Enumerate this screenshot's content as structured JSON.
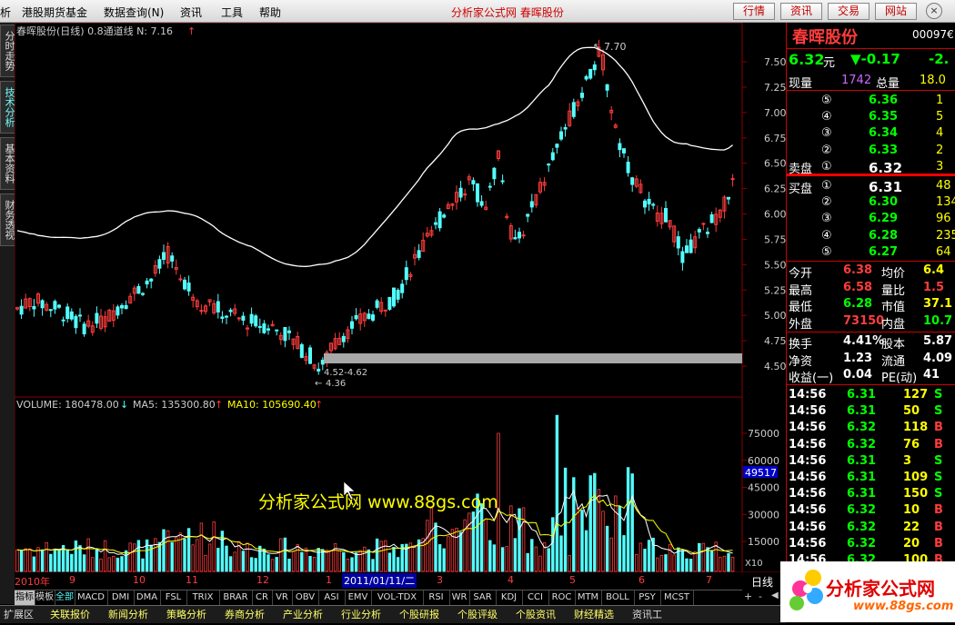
{
  "menubar": {
    "items": [
      "析",
      "港股期货基金",
      "数据查询(N)",
      "资讯",
      "工具",
      "帮助"
    ],
    "title": "分析家公式网 春晖股份",
    "buttons": [
      "行情",
      "资讯",
      "交易",
      "网站"
    ],
    "window_ctrl": "×"
  },
  "left_tabs": [
    "分时走势",
    "技术分析",
    "基本资料",
    "财务透视"
  ],
  "chart": {
    "header": "春晖股份(日线) 0.8通道线  N: 7.16",
    "peak_label": "7.70",
    "low_label": "4.36",
    "range_label": "4.52-4.62",
    "yticks": [
      "7.50",
      "7.25",
      "7.00",
      "6.75",
      "6.50",
      "6.25",
      "6.00",
      "5.75",
      "5.50",
      "5.25",
      "5.00",
      "4.75",
      "4.50"
    ],
    "volume_header": "VOLUME: 180478.00",
    "ma5": "MA5: 135300.80",
    "ma10": "MA10: 105690.40",
    "vol_ticks": [
      "75000",
      "60000",
      "45000",
      "30000",
      "15000"
    ],
    "vol_cursor": "49517",
    "x10": "X10",
    "watermark": "分析家公式网 www.88gs.com",
    "xaxis": [
      "2010年",
      "9",
      "10",
      "11",
      "12",
      "1",
      "2011/01/11/二",
      "3",
      "4",
      "5",
      "6",
      "7"
    ],
    "period": "日线",
    "colors": {
      "up": "#ff3c3c",
      "down": "#54ffff",
      "line": "#ffffff",
      "ma5": "#ffffff",
      "ma10": "#ffff00"
    }
  },
  "indicators": [
    "指标",
    "模板",
    "全部",
    "MACD",
    "DMI",
    "DMA",
    "FSL",
    "TRIX",
    "BRAR",
    "CR",
    "VR",
    "OBV",
    "ASI",
    "EMV",
    "VOL-TDX",
    "RSI",
    "WR",
    "SAR",
    "KDJ",
    "CCI",
    "ROC",
    "MTM",
    "BOLL",
    "PSY",
    "MCST"
  ],
  "bottom_tabs": [
    "扩展区",
    "关联报价",
    "新闻分析",
    "策略分析",
    "券商分析",
    "产业分析",
    "行业分析",
    "个股研报",
    "个股评级",
    "个股资讯",
    "财经精选",
    "资讯工"
  ],
  "quote": {
    "name": "春晖股份",
    "code": "00097€",
    "price": "6.32",
    "price_unit": "元",
    "change": "▼-0.17",
    "pct": "-2.",
    "xianliang_label": "现量",
    "xianliang": "1742",
    "zongliang_label": "总量",
    "zongliang": "18.0",
    "sell": [
      {
        "lv": "⑤",
        "price": "6.36",
        "vol": "1"
      },
      {
        "lv": "④",
        "price": "6.35",
        "vol": "5"
      },
      {
        "lv": "③",
        "price": "6.34",
        "vol": "4"
      },
      {
        "lv": "②",
        "price": "6.33",
        "vol": "2"
      },
      {
        "lv": "①",
        "price": "6.32",
        "vol": "3"
      }
    ],
    "sell_label": "卖盘",
    "buy_label": "买盘",
    "buy": [
      {
        "lv": "①",
        "price": "6.31",
        "vol": "48"
      },
      {
        "lv": "②",
        "price": "6.30",
        "vol": "134"
      },
      {
        "lv": "③",
        "price": "6.29",
        "vol": "96"
      },
      {
        "lv": "④",
        "price": "6.28",
        "vol": "235"
      },
      {
        "lv": "⑤",
        "price": "6.27",
        "vol": "64"
      }
    ],
    "stats": [
      {
        "l1": "今开",
        "v1": "6.38",
        "c1": "#ff3c3c",
        "l2": "均价",
        "v2": "6.4",
        "c2": "#ffff00"
      },
      {
        "l1": "最高",
        "v1": "6.58",
        "c1": "#ff3c3c",
        "l2": "量比",
        "v2": "1.5",
        "c2": "#ff3c3c"
      },
      {
        "l1": "最低",
        "v1": "6.28",
        "c1": "#00ff00",
        "l2": "市值",
        "v2": "37.1",
        "c2": "#ffff00"
      },
      {
        "l1": "外盘",
        "v1": "73150",
        "c1": "#ff3c3c",
        "l2": "内盘",
        "v2": "10.7",
        "c2": "#00ff00"
      }
    ],
    "stats2": [
      {
        "l1": "换手",
        "v1": "4.41%",
        "l2": "股本",
        "v2": "5.87"
      },
      {
        "l1": "净资",
        "v1": "1.23",
        "l2": "流通",
        "v2": "4.09"
      },
      {
        "l1": "收益(一)",
        "v1": "0.04",
        "l2": "PE(动)",
        "v2": "41"
      }
    ],
    "ticks": [
      {
        "t": "14:56",
        "p": "6.31",
        "v": "127",
        "s": "S"
      },
      {
        "t": "14:56",
        "p": "6.31",
        "v": "50",
        "s": "S"
      },
      {
        "t": "14:56",
        "p": "6.32",
        "v": "118",
        "s": "B"
      },
      {
        "t": "14:56",
        "p": "6.32",
        "v": "76",
        "s": "B"
      },
      {
        "t": "14:56",
        "p": "6.31",
        "v": "3",
        "s": "S"
      },
      {
        "t": "14:56",
        "p": "6.31",
        "v": "109",
        "s": "S"
      },
      {
        "t": "14:56",
        "p": "6.31",
        "v": "150",
        "s": "S"
      },
      {
        "t": "14:56",
        "p": "6.32",
        "v": "10",
        "s": "B"
      },
      {
        "t": "14:56",
        "p": "6.32",
        "v": "22",
        "s": "B"
      },
      {
        "t": "14:56",
        "p": "6.32",
        "v": "20",
        "s": "B"
      },
      {
        "t": "14:56",
        "p": "6.32",
        "v": "100",
        "s": "B"
      }
    ]
  },
  "logo": {
    "title": "分析家公式网",
    "url": "www.88gs.com"
  }
}
